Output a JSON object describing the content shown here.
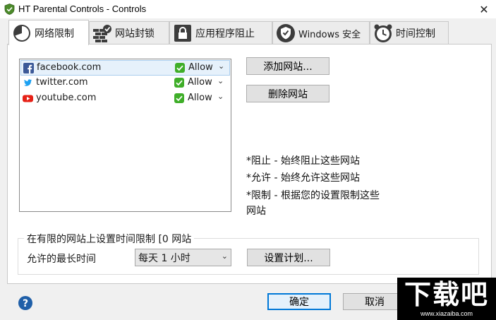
{
  "window": {
    "title": "HT Parental Controls - Controls",
    "close_glyph": "✕"
  },
  "tabs": [
    {
      "label": "网络限制",
      "icon": "pie-chart-icon",
      "active": true
    },
    {
      "label": "网站封锁",
      "icon": "brick-wall-icon",
      "active": false
    },
    {
      "label": "应用程序阻止",
      "icon": "padlock-icon",
      "active": false
    },
    {
      "label": "Windows 安全",
      "icon": "shield-check-icon",
      "active": false
    },
    {
      "label": "时间控制",
      "icon": "alarm-clock-icon",
      "active": false
    }
  ],
  "sites": [
    {
      "name": "facebook.com",
      "icon": "facebook-icon",
      "status": "Allow",
      "selected": true
    },
    {
      "name": "twitter.com",
      "icon": "twitter-icon",
      "status": "Allow",
      "selected": false
    },
    {
      "name": "youtube.com",
      "icon": "youtube-icon",
      "status": "Allow",
      "selected": false
    }
  ],
  "buttons": {
    "add_site": "添加网站...",
    "remove_site": "删除网站",
    "set_schedule": "设置计划...",
    "ok": "确定",
    "cancel": "取消"
  },
  "legend": {
    "block": "*阻止 - 始终阻止这些网站",
    "allow": "*允许 - 始终允许这些网站",
    "limit": "*限制 - 根据您的设置限制这些网站"
  },
  "time_limit": {
    "group_title": "在有限的网站上设置时间限制 [0 网站",
    "max_label": "允许的最长时间",
    "selected_value": "每天 1 小时"
  },
  "colors": {
    "accent": "#0078d7",
    "allow_green": "#3fae29",
    "facebook": "#3b5998",
    "twitter": "#1da1f2",
    "youtube": "#e62117"
  },
  "watermark": {
    "text": "下载吧",
    "url": "www.xiazaiba.com"
  }
}
